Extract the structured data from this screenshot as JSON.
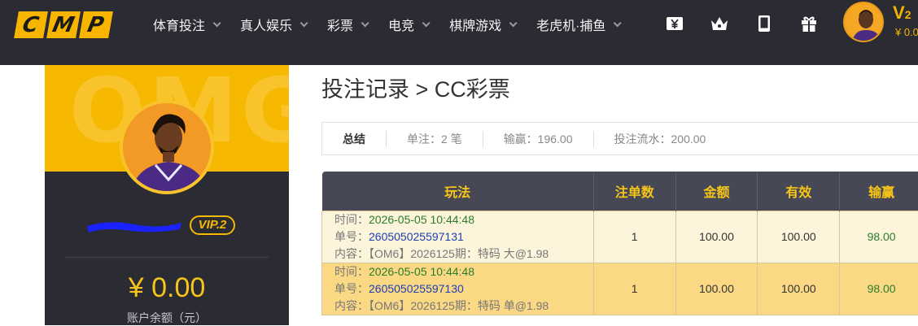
{
  "header": {
    "logo": [
      "C",
      "M",
      "P"
    ],
    "nav": [
      {
        "label": "体育投注"
      },
      {
        "label": "真人娱乐"
      },
      {
        "label": "彩票"
      },
      {
        "label": "电竞"
      },
      {
        "label": "棋牌游戏"
      },
      {
        "label": "老虎机·捕鱼"
      }
    ],
    "icons": [
      "currency-icon",
      "crown-icon",
      "mobile-icon",
      "gift-icon"
    ],
    "vip": "V",
    "vip_level": "2",
    "balance": "¥ 0.0"
  },
  "profile": {
    "banner_watermark": "OMG",
    "vip_badge": "VIP.2",
    "balance": "¥ 0.00",
    "balance_label": "账户余额（元）"
  },
  "page": {
    "title": "投注记录 > CC彩票"
  },
  "summary": {
    "title": "总结",
    "orders": "单注：2 笔",
    "win_loss": "输赢：196.00",
    "turnover": "投注流水：200.00"
  },
  "table": {
    "headers": [
      "玩法",
      "注单数",
      "金额",
      "有效",
      "输赢"
    ],
    "rows": [
      {
        "time_label": "时间：",
        "time": "2026-05-05 10:44:48",
        "order_label": "单号：",
        "order": "260505025597131",
        "content_label": "内容：",
        "content": "【OM6】2026125期：特码 大@1.98",
        "count": "1",
        "amount": "100.00",
        "valid": "100.00",
        "win": "98.00"
      },
      {
        "time_label": "时间：",
        "time": "2026-05-05 10:44:48",
        "order_label": "单号：",
        "order": "260505025597130",
        "content_label": "内容：",
        "content": "【OM6】2026125期：特码 单@1.98",
        "count": "1",
        "amount": "100.00",
        "valid": "100.00",
        "win": "98.00"
      }
    ]
  },
  "colors": {
    "accent": "#f6b800",
    "header_bg": "#2b2b34",
    "table_header_bg": "#474856",
    "row1_bg": "#fdf4dc",
    "row2_bg": "#fad884"
  }
}
